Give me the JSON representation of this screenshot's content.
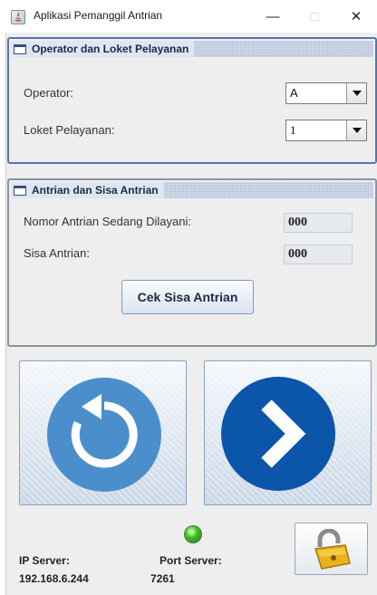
{
  "window": {
    "title": "Aplikasi Pemanggil Antrian",
    "controls": [
      "minimize",
      "maximize",
      "close"
    ]
  },
  "operator_panel": {
    "title": "Operator dan Loket Pelayanan",
    "operator_label": "Operator:",
    "operator_value": "A",
    "loket_label": "Loket Pelayanan:",
    "loket_value": "1"
  },
  "queue_panel": {
    "title": "Antrian dan Sisa Antrian",
    "current_label": "Nomor Antrian Sedang Dilayani:",
    "current_value": "000",
    "remaining_label": "Sisa Antrian:",
    "remaining_value": "000",
    "check_button": "Cek Sisa Antrian"
  },
  "actions": {
    "repeat_icon": "replay-icon",
    "next_icon": "next-chevron-icon",
    "accent_color": "#4a8fcb",
    "next_color": "#0b56a8"
  },
  "server": {
    "ip_label": "IP Server:",
    "ip_value": "192.168.6.244",
    "port_label": "Port Server:",
    "port_value": "7261",
    "status_color": "#3fbf26",
    "lock_icon": "unlocked-padlock-icon"
  }
}
